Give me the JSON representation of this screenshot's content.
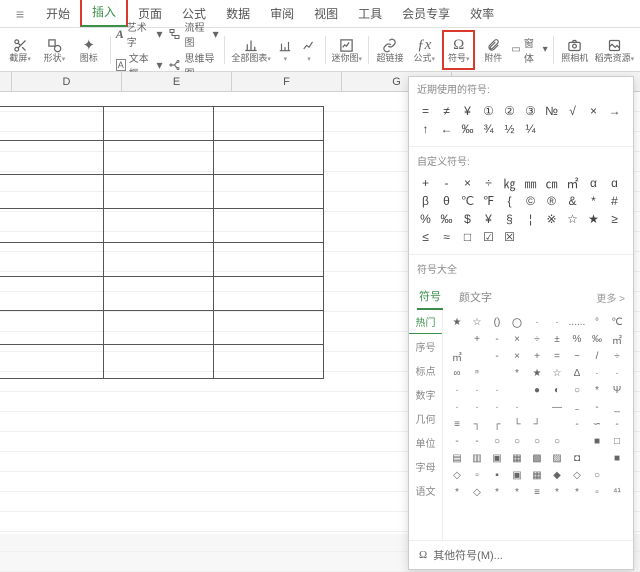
{
  "menu": {
    "lead": "≡",
    "items": [
      "开始",
      "插入",
      "页面",
      "公式",
      "数据",
      "审阅",
      "视图",
      "工具",
      "会员专享",
      "效率"
    ],
    "active_index": 1
  },
  "ribbon": {
    "groups": [
      {
        "label": "截屏",
        "dropdown": true
      },
      {
        "label": "形状",
        "dropdown": true
      },
      {
        "label": "图标"
      },
      {
        "label": "艺术字",
        "inline": "A",
        "dropdown": true
      },
      {
        "label": "文本框",
        "inline": "A",
        "dropdown": true
      },
      {
        "label": "流程图",
        "dropdown": true
      },
      {
        "label": "思维导图"
      },
      {
        "label": "全部图表",
        "dropdown": true
      },
      {
        "label": "",
        "dropdown": true
      },
      {
        "label": "",
        "dropdown": true
      },
      {
        "label": "迷你图",
        "dropdown": true
      },
      {
        "label": "超链接"
      },
      {
        "label": "公式",
        "dropdown": true
      },
      {
        "label": "符号",
        "dropdown": true
      },
      {
        "label": "附件"
      },
      {
        "label": "窗体",
        "dropdown": true
      },
      {
        "label": "照相机"
      },
      {
        "label": "稻壳资源",
        "dropdown": true
      }
    ]
  },
  "columns": [
    "D",
    "E",
    "F",
    "G"
  ],
  "popup": {
    "recent_title": "近期使用的符号:",
    "recent": [
      "=",
      "≠",
      "¥",
      "①",
      "②",
      "③",
      "№",
      "√",
      "×",
      "→",
      "↑",
      "←",
      "‰",
      "¾",
      "½",
      "¼"
    ],
    "custom_title": "自定义符号:",
    "custom": [
      "+",
      "-",
      "×",
      "÷",
      "㎏",
      "㎜",
      "㎝",
      "㎡",
      "α",
      "ɑ",
      "β",
      "θ",
      "℃",
      "℉",
      "{",
      "©",
      "®",
      "&",
      "*",
      "#",
      "%",
      "‰",
      "$",
      "¥",
      "§",
      "¦",
      "※",
      "☆",
      "★",
      "≥",
      "≤",
      "≈",
      "□",
      "☑",
      "☒"
    ],
    "all_title": "符号大全",
    "tabs": [
      "符号",
      "颜文字"
    ],
    "more": "更多 >",
    "cats": [
      "热门",
      "序号",
      "标点",
      "数字",
      "几何",
      "单位",
      "字母",
      "语文"
    ],
    "grid": [
      "★",
      "☆",
      "()",
      "〇",
      "·",
      "·",
      "......",
      "°",
      "℃",
      " ",
      "+",
      "-",
      "×",
      "÷",
      "±",
      "%",
      "‰",
      "㎡",
      "㎥",
      " ",
      "-",
      "×",
      "+",
      "=",
      "~",
      "/",
      "÷",
      "∞",
      "ⁿ",
      " ",
      "*",
      "★",
      "☆",
      "Δ",
      "·",
      "·",
      "·",
      "·",
      "·",
      " ",
      "●",
      "◐",
      "○",
      "*",
      "Ψ",
      "·",
      "·",
      "·",
      "·",
      " ",
      "—",
      "﹣",
      "-",
      "_",
      "≡",
      "┐",
      "┌",
      "└",
      "┘",
      " ",
      "-",
      "∽",
      "-",
      "-",
      "-",
      "○",
      "○",
      "○",
      "○",
      " ",
      "■",
      "□",
      "▤",
      "▥",
      "▣",
      "▦",
      "▩",
      "▨",
      "◘",
      " ",
      "■",
      "◇",
      "▫",
      "▪",
      "▣",
      "▦",
      "◆",
      "◇",
      "○",
      " ",
      "*",
      "◇",
      "*",
      "*",
      "≡",
      "*",
      "*",
      "▫",
      "⁴¹"
    ],
    "footer": "其他符号(M)..."
  }
}
